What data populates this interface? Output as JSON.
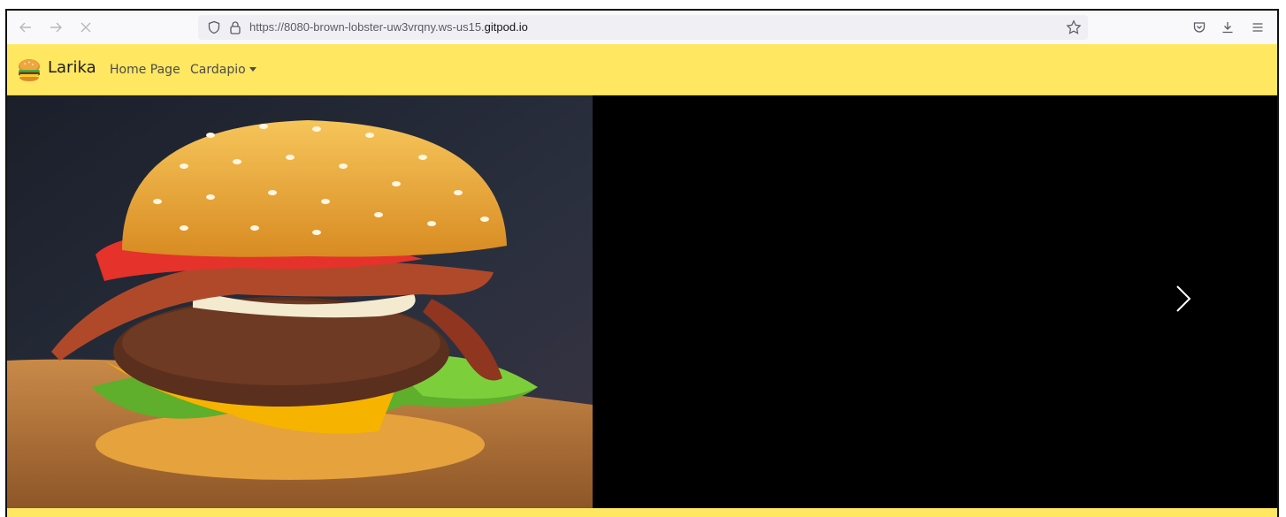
{
  "browser": {
    "url_prefix": "https://8080-brown-lobster-uw3vrqny.ws-us15.",
    "url_domain": "gitpod.io",
    "icons": {
      "back": "back-arrow-icon",
      "forward": "forward-arrow-icon",
      "stop": "close-icon",
      "shield": "shield-icon",
      "lock": "lock-icon",
      "bookmark": "star-icon",
      "pocket": "pocket-icon",
      "downloads": "download-icon",
      "menu": "hamburger-menu-icon"
    }
  },
  "navbar": {
    "brand": "Larika",
    "links": [
      {
        "label": "Home Page"
      },
      {
        "label": "Cardapio",
        "dropdown": true
      }
    ],
    "background": "#ffe761"
  },
  "carousel": {
    "slide_image": "burger-photo",
    "next_icon": "chevron-right-icon",
    "background": "#000000"
  }
}
